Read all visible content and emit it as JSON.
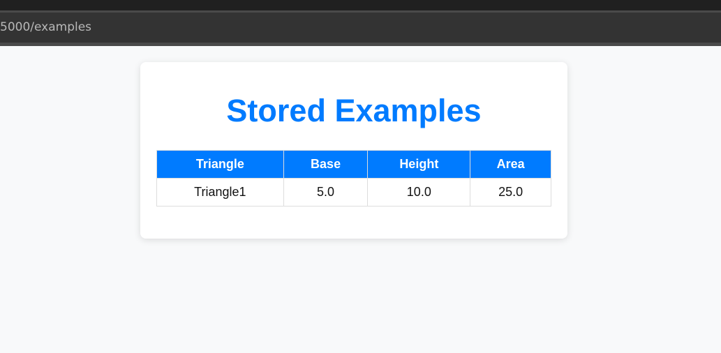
{
  "browser": {
    "url_fragment": "5000/examples"
  },
  "page": {
    "title": "Stored Examples",
    "table": {
      "headers": [
        "Triangle",
        "Base",
        "Height",
        "Area"
      ],
      "rows": [
        [
          "Triangle1",
          "5.0",
          "10.0",
          "25.0"
        ]
      ]
    }
  },
  "colors": {
    "accent": "#007bff",
    "background": "#f8f9fa",
    "card": "#ffffff"
  }
}
